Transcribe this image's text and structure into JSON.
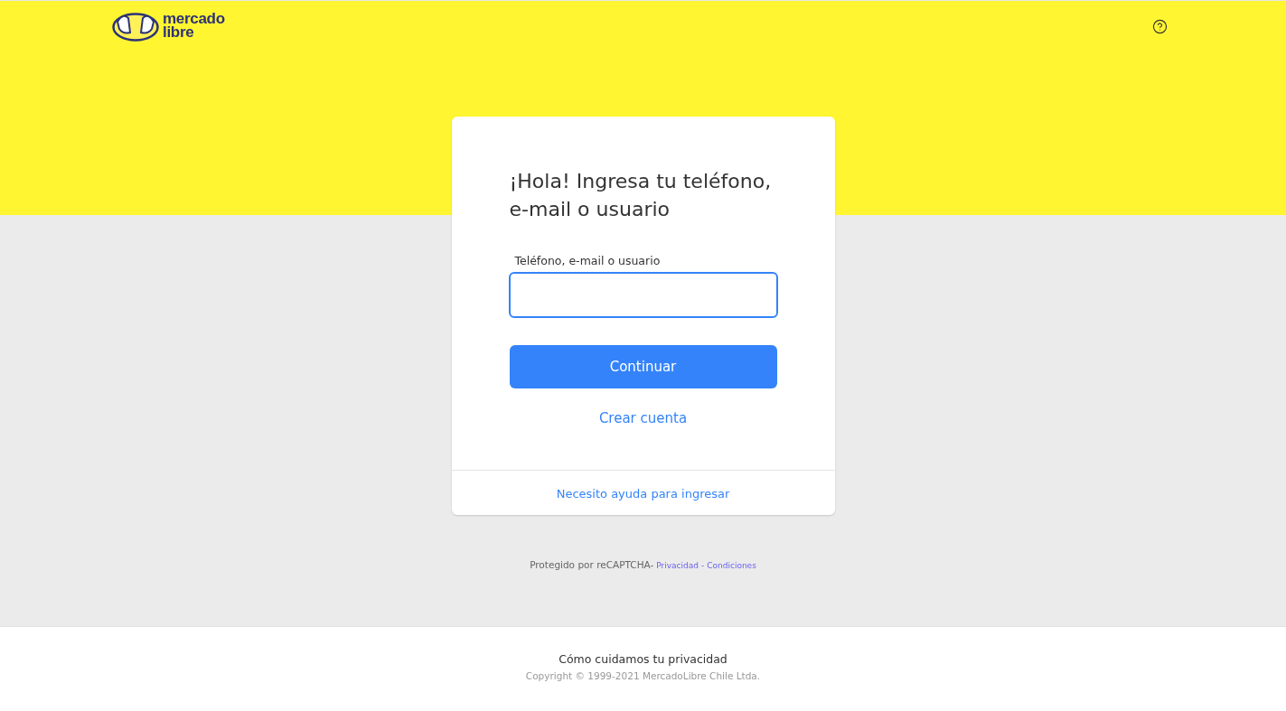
{
  "header": {
    "logo": {
      "line_1": "mercado",
      "line_2": "libre"
    }
  },
  "login_card": {
    "title": "¡Hola! Ingresa tu teléfono, e-mail o usuario",
    "field": {
      "label": "Teléfono, e-mail o usuario",
      "focused": true
    },
    "primary_button": "Continuar",
    "secondary_link": "Crear cuenta",
    "help_link": "Necesito ayuda para ingresar"
  },
  "recaptcha": {
    "text": "Protegido por reCAPTCHA-",
    "links": [
      "Privacidad",
      "Condiciones"
    ],
    "separator": "-"
  },
  "footer": {
    "privacy_link": "Cómo cuidamos tu privacidad",
    "copyright": "Copyright © 1999-2021 MercadoLibre Chile Ltda."
  }
}
